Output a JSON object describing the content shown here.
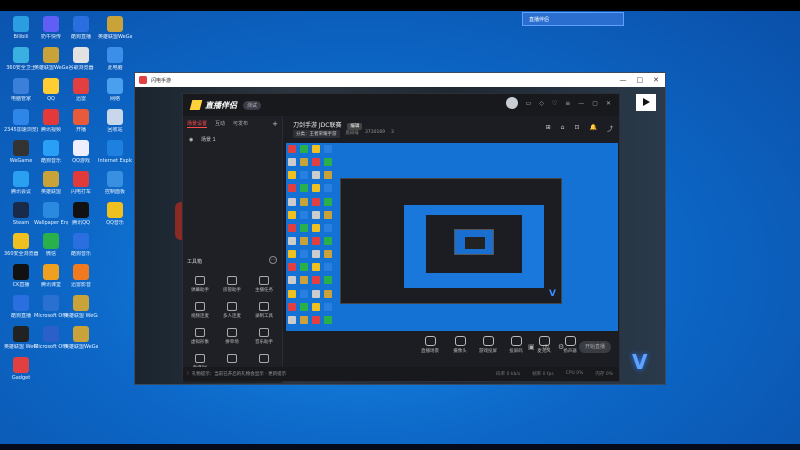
{
  "desktop": {
    "icons": [
      {
        "label": "Bilibili",
        "color": "#2a9ee0"
      },
      {
        "label": "奶牛快传",
        "color": "#5f5ff5"
      },
      {
        "label": "酷狗直播",
        "color": "#2a6ee0"
      },
      {
        "label": "英雄联盟WeGame版",
        "color": "#c9a23a"
      },
      {
        "label": "360安全卫士",
        "color": "#3ab0e0"
      },
      {
        "label": "英雄联盟WeGame版",
        "color": "#c9a23a"
      },
      {
        "label": "谷歌浏览器",
        "color": "#e2e2e2"
      },
      {
        "label": "此电脑",
        "color": "#3b8fe8"
      },
      {
        "label": "电脑管家",
        "color": "#3a7fd8"
      },
      {
        "label": "QQ",
        "color": "#ffcc33"
      },
      {
        "label": "迅雷",
        "color": "#e24040"
      },
      {
        "label": "网络",
        "color": "#4aa0ee"
      },
      {
        "label": "2345加速浏览器",
        "color": "#2d86e8"
      },
      {
        "label": "腾讯视频",
        "color": "#e23a3a"
      },
      {
        "label": "开播",
        "color": "#e85a3a"
      },
      {
        "label": "回收站",
        "color": "#c8d8ea"
      },
      {
        "label": "WeGame",
        "color": "#333"
      },
      {
        "label": "酷狗音乐",
        "color": "#29a0f5"
      },
      {
        "label": "QQ游戏",
        "color": "#eef"
      },
      {
        "label": "Internet Explorer",
        "color": "#1e80e0"
      },
      {
        "label": "腾讯会议",
        "color": "#2aa0f0"
      },
      {
        "label": "英雄联盟",
        "color": "#c9a23a"
      },
      {
        "label": "闪电打车",
        "color": "#e03a3a"
      },
      {
        "label": "控制面板",
        "color": "#3a90e0"
      },
      {
        "label": "Steam",
        "color": "#1a2a4a"
      },
      {
        "label": "Wallpaper Engine",
        "color": "#2a8ae0"
      },
      {
        "label": "腾讯QQ",
        "color": "#111"
      },
      {
        "label": "QQ音乐",
        "color": "#f0c020"
      },
      {
        "label": "360安全浏览器",
        "color": "#f0c020"
      },
      {
        "label": "微信",
        "color": "#2ab04a"
      },
      {
        "label": "酷狗音乐",
        "color": "#2a6ee0"
      },
      {
        "label": "CK直播",
        "color": "#111"
      },
      {
        "label": "腾讯课堂",
        "color": "#f0a020"
      },
      {
        "label": "迅雷影音",
        "color": "#f07a20"
      },
      {
        "label": "酷狗直播",
        "color": "#2a6ee0"
      },
      {
        "label": "Microsoft Office Exc...",
        "color": "#2a70d0"
      },
      {
        "label": "英雄联盟 WeGame版",
        "color": "#c9a23a"
      },
      {
        "label": "英雄联盟 WeGame版",
        "color": "#222"
      },
      {
        "label": "Microsoft Office Wo...",
        "color": "#2a60c8"
      },
      {
        "label": "英雄联盟WeGame版",
        "color": "#c9a23a"
      },
      {
        "label": "Gadget",
        "color": "#e24040"
      }
    ],
    "topleft_text": "3788601",
    "task_chip": "直播伴侣"
  },
  "outer_window": {
    "title": "闪电手游",
    "controls": [
      "—",
      "□",
      "✕"
    ]
  },
  "app": {
    "brand": "直播伴侣",
    "version": "测试",
    "header_icons": [
      "▭",
      "◇",
      "♡",
      "≡",
      "—",
      "▢",
      "✕"
    ],
    "tabs": [
      "场景设置",
      "互动",
      "可发布"
    ],
    "add_tab": "+",
    "scene": "场景 1",
    "tools_label": "工具箱",
    "tools_more": "···",
    "tools": [
      "弹幕助手",
      "房管助手",
      "主播任务",
      "视频连麦",
      "多人连麦",
      "录制工具",
      "虚拟形象",
      "拼单场",
      "音乐助手",
      "直播PK",
      "",
      ""
    ],
    "game_name": "刀剑手游 JDC联赛",
    "edit_label": "编辑",
    "category": "分类：",
    "category_value": "王者荣耀手游",
    "room_label": "房间号",
    "room_number": "3730169",
    "likes": "3",
    "head_icons": [
      "⊞",
      "⌂",
      "⊡",
      "🔔",
      "⤴"
    ],
    "bottom_tools": [
      {
        "label": "直播场景"
      },
      {
        "label": "摄像头"
      },
      {
        "label": "游戏投屏"
      },
      {
        "label": "投屏码"
      },
      {
        "label": "麦克风"
      },
      {
        "label": "扬声器"
      }
    ],
    "start_button": "开始直播",
    "status_warn": "!",
    "status_text": "礼物提示：当前已开启的礼物会显示 · 更新提示",
    "stats": [
      "码率 0 kb/s",
      "帧率 0 fps",
      "CPU 0%",
      "内存 0%"
    ]
  }
}
